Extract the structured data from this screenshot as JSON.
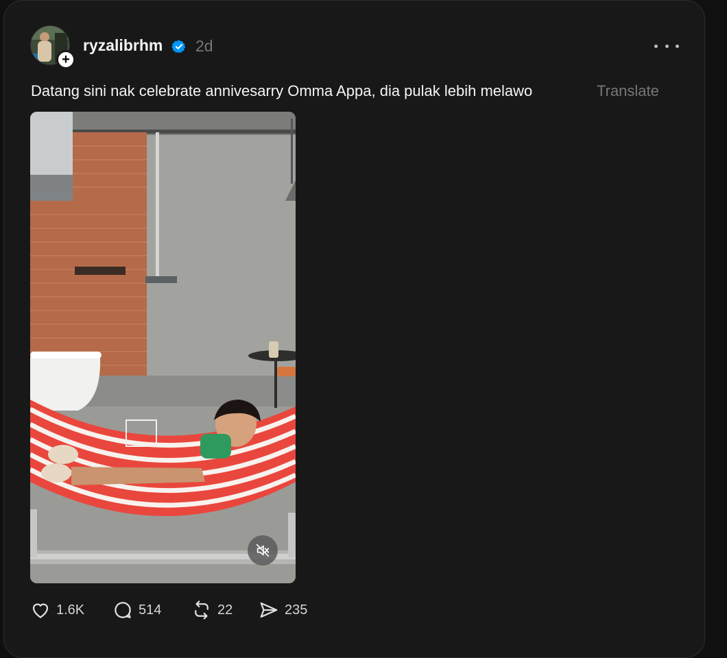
{
  "post": {
    "username": "ryzalibrhm",
    "timestamp": "2d",
    "caption": "Datang sini nak celebrate annivesarry Omma Appa, dia pulak lebih melawo",
    "translate_label": "Translate",
    "verified": true
  },
  "icons": {
    "avatar": "avatar-image",
    "follow": "plus-icon",
    "verified": "verified-badge-icon",
    "more": "more-options-icon",
    "mute": "muted-speaker-icon",
    "like": "heart-icon",
    "reply": "comment-bubble-icon",
    "repost": "repost-icon",
    "share": "send-icon"
  },
  "actions": {
    "likes": "1.6K",
    "replies": "514",
    "reposts": "22",
    "shares": "235"
  },
  "colors": {
    "background": "#101010",
    "card": "#181818",
    "text": "#f3f5f7",
    "muted_text": "#777777",
    "verified": "#0095f6"
  }
}
